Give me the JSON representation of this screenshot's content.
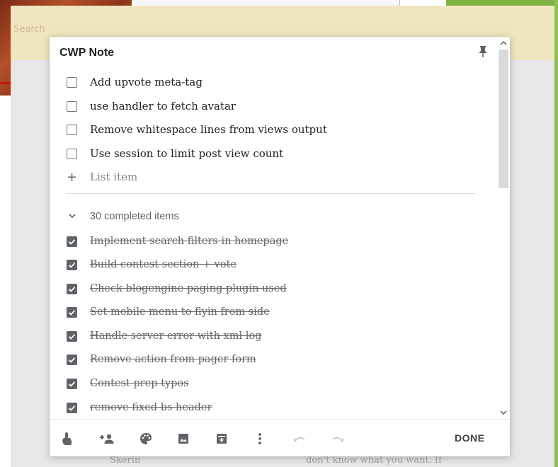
{
  "background": {
    "header_hint": "Search"
  },
  "note": {
    "title": "CWP Note",
    "unchecked_items": [
      "Add upvote meta-tag",
      "use handler to fetch avatar",
      "Remove whitespace lines from views output",
      "Use session to limit post view count"
    ],
    "add_item_placeholder": "List item",
    "completed_label": "30 completed items",
    "completed_items": [
      "Implement search filters in homepage",
      "Build contest section + vote",
      "Check blogengine paging plugin used",
      "Set mobile menu to flyin from side",
      "Handle server error with xml log",
      "Remove action from pager form",
      "Contest prep typos",
      "remove fixed bs header"
    ]
  },
  "toolbar": {
    "icons": [
      "reminder-icon",
      "collaborator-icon",
      "palette-icon",
      "image-icon",
      "archive-icon",
      "more-icon",
      "undo-icon",
      "redo-icon"
    ],
    "done_label": "DONE"
  },
  "colors": {
    "header_bg": "#efe5bf",
    "page_bg": "#e7e7e9",
    "checkbox_fill": "#5f6368",
    "accent_green": "#8bc34a"
  },
  "behind_text": {
    "left": "Skerin",
    "right": "don't know what you want. If"
  }
}
